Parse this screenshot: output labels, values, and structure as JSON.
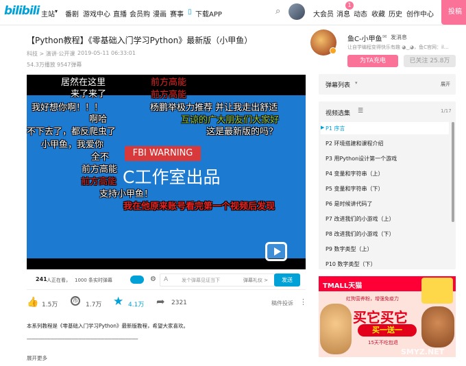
{
  "topnav": {
    "logo": "bilibili",
    "items": [
      "主站",
      "番剧",
      "游戏中心",
      "直播",
      "会员购",
      "漫画",
      "赛事"
    ],
    "download": "下载APP",
    "right_items": [
      "大会员",
      "消息",
      "动态",
      "收藏",
      "历史",
      "创作中心"
    ],
    "message_badge": "1",
    "upload": "投稿"
  },
  "video": {
    "title": "【Python教程】《零基础入门学习Python》最新版（小甲鱼）",
    "category": "科技 > 演讲·公开课",
    "date": "2019-05-11 06:33:01",
    "plays": "54.3万播放",
    "danmaku_count": "9547弹幕"
  },
  "uploader": {
    "name": "鱼C-小甲鱼",
    "message_link": "发消息",
    "bio": "让自学编程变得快乐有趣 ◕‿◕，鱼C官网：il...",
    "charge_button": "为TA充电",
    "follow_button": "已关注 25.8万"
  },
  "player": {
    "screen_banner": "FBI WARNING",
    "screen_text": "C工作室出品",
    "danmaku": [
      {
        "text": "居然在这里",
        "color": "w"
      },
      {
        "text": "来了来了",
        "color": "w"
      },
      {
        "text": "我好想你啊！！！",
        "color": "w"
      },
      {
        "text": "啊哈",
        "color": "w"
      },
      {
        "text": "不下去了，都反爬虫了",
        "color": "w"
      },
      {
        "text": "小甲鱼，我爱你",
        "color": "w"
      },
      {
        "text": "全不",
        "color": "w"
      },
      {
        "text": "前方高能",
        "color": "w"
      },
      {
        "text": "前方高能",
        "color": "r"
      },
      {
        "text": "支持小甲鱼！",
        "color": "w"
      },
      {
        "text": "前方高能",
        "color": "r"
      },
      {
        "text": "前方高能",
        "color": "r"
      },
      {
        "text": "杨鹏举极力推荐 并让我走出舒适",
        "color": "w"
      },
      {
        "text": "互谅的广大朋友们大家好",
        "color": "g"
      },
      {
        "text": "这是最新版的吗？",
        "color": "w"
      },
      {
        "text": "我在他原来账号看完第一个视频后发现",
        "color": "r"
      }
    ]
  },
  "sendbar": {
    "viewers": "241",
    "viewers_label": "人正在看，",
    "live_danmaku": "1000 条实时弹幕",
    "input_placeholder": "发个弹幕见证当下",
    "etiquette": "弹幕礼仪 >",
    "send": "发送"
  },
  "stats": {
    "likes": "1.5万",
    "coins": "1.7万",
    "favorites": "4.1万",
    "shares": "2321",
    "report": "稿件投诉"
  },
  "description": {
    "text": "本系列教程是《零基础入门学习Python》最新版教程，希望大家喜欢。",
    "divider": "--------------------------------------------------------------------------------",
    "expand": "展开更多"
  },
  "danmaku_panel": {
    "title": "弹幕列表",
    "expand": "展开"
  },
  "playlist": {
    "title": "视频选集",
    "progress": "1/17",
    "items": [
      "P1  序言",
      "P2  环境搭建和课程介绍",
      "P3  用Python设计第一个游戏",
      "P4  变量和字符串（上）",
      "P5  变量和字符串（下）",
      "P6  是时候讲代码了",
      "P7  改进我们的小游戏（上）",
      "P8  改进我们的小游戏（下）",
      "P9  数字类型（上）",
      "P10  数字类型（下）"
    ]
  },
  "ad": {
    "brand": "TMALL天猫",
    "slogan": "红狗营养粉，增强免疫力",
    "headline": "买它买它",
    "promo": "买一送一",
    "subpromo": "15天不吃包退",
    "watermark": "SMYZ.NET"
  },
  "colors": {
    "brand_blue": "#00a1d6",
    "pink": "#fb7299",
    "screen_blue": "#1d7ad1",
    "fbi_red": "#d8393b"
  }
}
